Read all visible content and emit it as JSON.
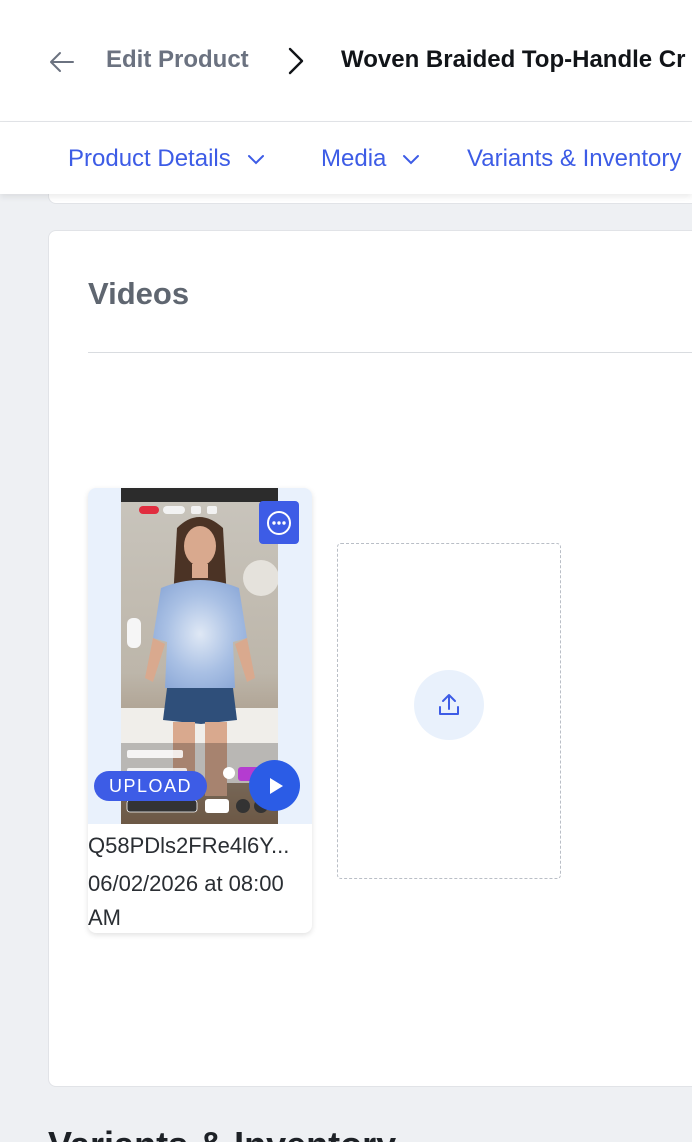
{
  "header": {
    "back_icon": "arrow-left-icon",
    "parent": "Edit Product",
    "separator_icon": "chevron-right-icon",
    "current": "Woven Braided Top-Handle Cr"
  },
  "tabs": [
    {
      "label": "Product Details",
      "icon": "chevron-down-icon"
    },
    {
      "label": "Media",
      "icon": "chevron-down-icon"
    },
    {
      "label": "Variants & Inventory"
    }
  ],
  "videos_section": {
    "title": "Videos",
    "items": [
      {
        "name": "Q58PDls2FRe4l6Y...",
        "date": "06/02/2026 at 08:00 AM",
        "badge": "UPLOAD",
        "actions": [
          "more-options-icon",
          "play-icon"
        ],
        "thumbnail": "woman in tie-dye top video thumbnail"
      }
    ],
    "dropzone_icon": "upload-icon"
  },
  "next_section": {
    "title": "Variants & Inventory"
  },
  "colors": {
    "accent": "#3d5ce6",
    "play": "#2b5ce6",
    "page_bg": "#eef0f3",
    "tile_bg": "#e9f1fc"
  }
}
